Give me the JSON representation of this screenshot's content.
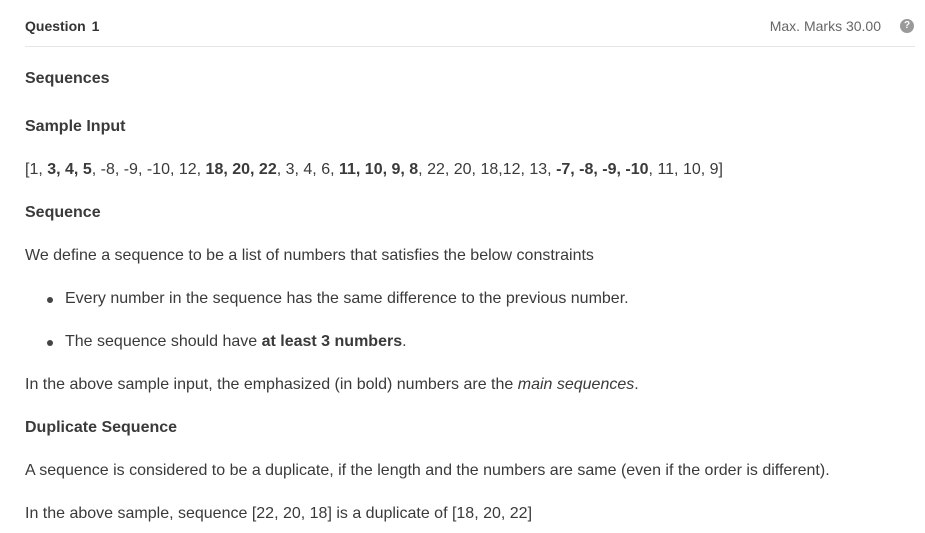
{
  "header": {
    "question_label": "Question",
    "question_number": "1",
    "marks": "Max. Marks 30.00",
    "help_icon": "question-circle-icon"
  },
  "content": {
    "title": "Sequences",
    "sample_input_heading": "Sample Input",
    "sample_input_parts": [
      {
        "t": "[1, ",
        "b": false
      },
      {
        "t": "3, 4, 5",
        "b": true
      },
      {
        "t": ", -8, -9, -10, 12, ",
        "b": false
      },
      {
        "t": "18, 20, 22",
        "b": true
      },
      {
        "t": ", 3, 4, 6, ",
        "b": false
      },
      {
        "t": "11, 10, 9, 8",
        "b": true
      },
      {
        "t": ", 22, 20, 18,12, 13, ",
        "b": false
      },
      {
        "t": "-7, -8, -9, -10",
        "b": true
      },
      {
        "t": ", 11, 10, 9]",
        "b": false
      }
    ],
    "sequence_heading": "Sequence",
    "definition": "We define a sequence to be a list of numbers that satisfies the below constraints",
    "bullet1": "Every number in the sequence has the same difference to the previous number.",
    "bullet2_prefix": "The sequence should have ",
    "bullet2_bold": "at least 3 numbers",
    "bullet2_suffix": ".",
    "emph_prefix": "In the above sample input, the emphasized (in bold) numbers are the ",
    "emph_italic": "main sequences",
    "emph_suffix": ".",
    "duplicate_heading": "Duplicate Sequence",
    "duplicate_text": "A sequence is considered to be a duplicate, if the length and the numbers are same (even if the order is different).",
    "duplicate_example": "In the above sample, sequence [22, 20, 18] is a duplicate of  [18, 20, 22]"
  }
}
